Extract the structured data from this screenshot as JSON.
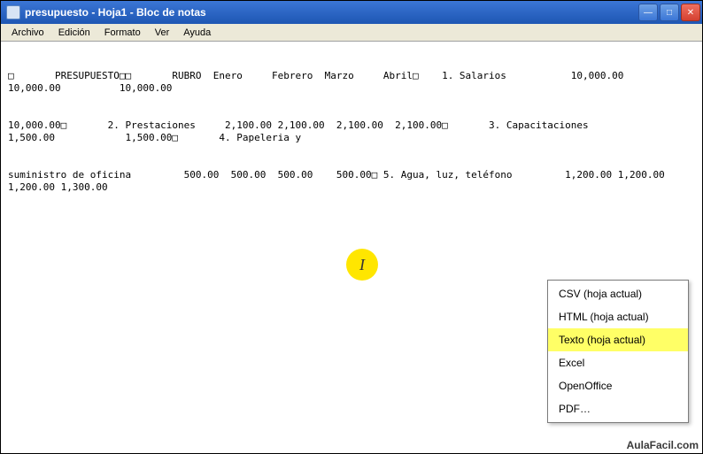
{
  "window": {
    "title": "presupuesto - Hoja1 - Bloc de notas"
  },
  "menubar": {
    "items": [
      {
        "label": "Archivo"
      },
      {
        "label": "Edición"
      },
      {
        "label": "Formato"
      },
      {
        "label": "Ver"
      },
      {
        "label": "Ayuda"
      }
    ]
  },
  "content": {
    "line1": "□       PRESUPUESTO□□       RUBRO  Enero     Febrero  Marzo     Abril□    1. Salarios           10,000.00          10,000.00          10,000.00",
    "line2": "10,000.00□       2. Prestaciones     2,100.00 2,100.00  2,100.00  2,100.00□       3. Capacitaciones           1,500.00            1,500.00□       4. Papeleria y",
    "line3": "suministro de oficina         500.00  500.00  500.00    500.00□ 5. Agua, luz, teléfono         1,200.00 1,200.00 1,200.00 1,300.00"
  },
  "cursor_marker": {
    "symbol": "I"
  },
  "context_menu": {
    "items": [
      {
        "label": "CSV (hoja actual)"
      },
      {
        "label": "HTML (hoja actual)"
      },
      {
        "label": "Texto (hoja actual)",
        "highlighted": true
      },
      {
        "label": "Excel"
      },
      {
        "label": "OpenOffice"
      },
      {
        "label": "PDF…"
      }
    ]
  },
  "watermark": {
    "text": "AulaFacil.com"
  },
  "win_controls": {
    "minimize": "—",
    "maximize": "□",
    "close": "✕"
  }
}
